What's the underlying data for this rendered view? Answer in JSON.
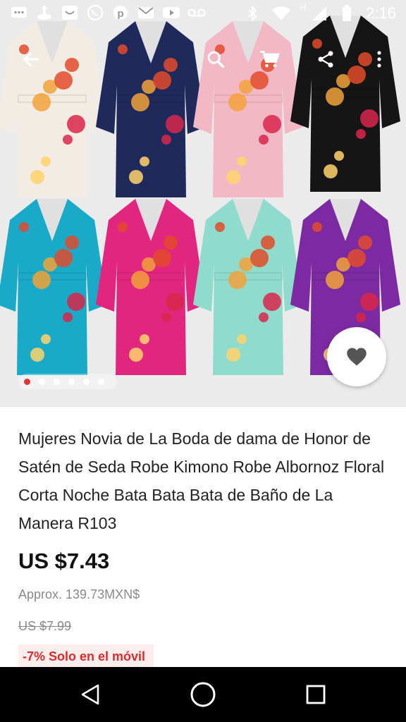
{
  "status_bar": {
    "time": "2:16",
    "carrier_mark": "H",
    "icons_left": [
      "message-icon",
      "chef-hat-icon",
      "smile-box-icon",
      "whatsapp-icon",
      "pinterest-icon",
      "gmail-icon",
      "youtube-icon",
      "voicemail-icon"
    ],
    "icons_right": [
      "bluetooth-icon",
      "wifi-icon",
      "signal-icon",
      "battery-icon"
    ]
  },
  "toolbar": {
    "back": "back-arrow-icon",
    "search": "search-icon",
    "cart": "cart-icon",
    "share": "share-icon",
    "more": "more-vert-icon"
  },
  "gallery": {
    "dot_count": 6,
    "active_index": 0,
    "robe_colors": [
      "#f3ece4",
      "#1f2a5c",
      "#f3b8c6",
      "#151515",
      "#19a9c9",
      "#e2267f",
      "#8fdccc",
      "#7b2aa1"
    ]
  },
  "product": {
    "title": "Mujeres Novia de La Boda de dama de Honor de Satén de Seda Robe Kimono Robe Albornoz Floral Corta Noche Bata Bata Bata de Baño de La Manera R103",
    "price": "US $7.43",
    "approx": "Approx. 139.73MXN$",
    "original_price": "US $7.99",
    "promo": "-7%  Solo en el móvil"
  },
  "colors": {
    "accent": "#e02b2b",
    "promo_bg": "#fdeeee"
  }
}
